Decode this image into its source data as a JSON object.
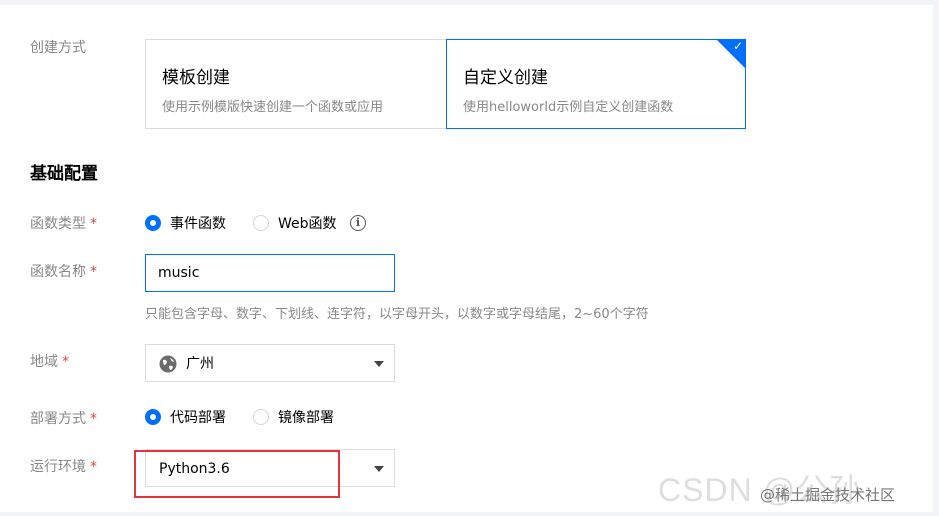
{
  "creation_method": {
    "label": "创建方式",
    "options": [
      {
        "title": "模板创建",
        "desc": "使用示例模版快速创建一个函数或应用"
      },
      {
        "title": "自定义创建",
        "desc": "使用helloworld示例自定义创建函数"
      }
    ],
    "selected_check": "✓"
  },
  "section_title": "基础配置",
  "required_mark": "*",
  "function_type": {
    "label": "函数类型",
    "options": [
      "事件函数",
      "Web函数"
    ],
    "info_icon": "info-icon",
    "info_glyph": "i"
  },
  "function_name": {
    "label": "函数名称",
    "value": "music",
    "hint": "只能包含字母、数字、下划线、连字符，以字母开头，以数字或字母结尾，2~60个字符"
  },
  "region": {
    "label": "地域",
    "value": "广州",
    "icon": "globe-icon"
  },
  "deploy_method": {
    "label": "部署方式",
    "options": [
      "代码部署",
      "镜像部署"
    ]
  },
  "runtime": {
    "label": "运行环境",
    "value": "Python3.6"
  },
  "watermark": {
    "main": "CSDN @公孙",
    "credit": "@稀土掘金技术社区"
  },
  "colors": {
    "accent": "#006eff",
    "required": "#e54545",
    "highlight": "#e0353b"
  }
}
